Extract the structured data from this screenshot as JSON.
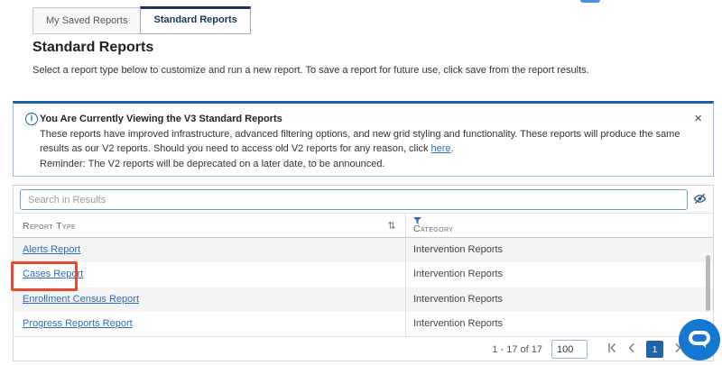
{
  "colors": {
    "accent_blue": "#2262a9",
    "link_blue": "#2a6ebb",
    "banner_border_blue": "#1b5fa8",
    "highlight_red": "#e64a33",
    "chat_button_blue": "#1677d3",
    "alt_row_gray": "#f4f4f4"
  },
  "tabs": [
    {
      "label": "My Saved Reports"
    },
    {
      "label": "Standard Reports"
    }
  ],
  "page": {
    "title": "Standard Reports",
    "subtitle": "Select a report type below to customize and run a new report. To save a report for future use, click save from the report results."
  },
  "banner": {
    "title": "You Are Currently Viewing the V3 Standard Reports",
    "body_before_link": "These reports have improved infrastructure, advanced filtering options, and new grid styling and functionality. These reports will produce the same results as our V2 reports. Should you need to access old V2 reports for any reason, click ",
    "link_text": "here",
    "body_after_link": ".",
    "reminder": "Reminder: The V2 reports will be deprecated on a later date, to be announced.",
    "close_glyph": "×"
  },
  "search": {
    "placeholder": "Search in Results"
  },
  "table": {
    "sort_glyph": "⇅",
    "columns": [
      {
        "label": "Report Type"
      },
      {
        "label": "Category"
      }
    ],
    "rows": [
      {
        "report_type": "Alerts Report",
        "category": "Intervention Reports"
      },
      {
        "report_type": "Cases Report",
        "category": "Intervention Reports"
      },
      {
        "report_type": "Enrollment Census Report",
        "category": "Intervention Reports"
      },
      {
        "report_type": "Progress Reports Report",
        "category": "Intervention Reports"
      }
    ]
  },
  "pager": {
    "range_text": "1 - 17 of 17",
    "page_size": "100",
    "current_page": "1"
  }
}
